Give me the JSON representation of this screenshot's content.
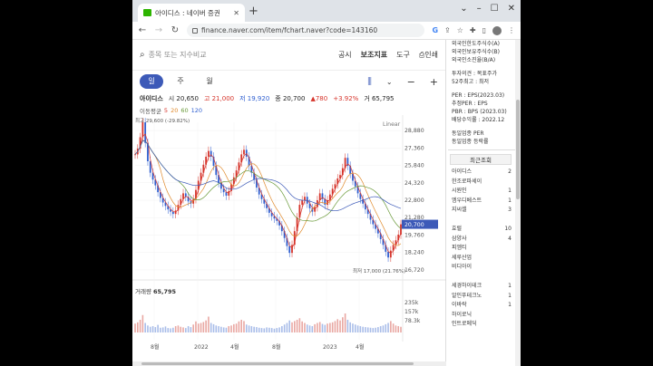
{
  "browser": {
    "tab_title": "아이디스 : 네이버 증권",
    "url": "finance.naver.com/item/fchart.naver?code=143160"
  },
  "toolbar": {
    "search_placeholder": "종목 또는 지수비교",
    "items": [
      "공시",
      "보조지표",
      "도구",
      "인쇄"
    ]
  },
  "periods": [
    "일",
    "주",
    "월"
  ],
  "active_period": "일",
  "quote": {
    "name": "아이디스",
    "open": "시 20,650",
    "high": "고 21,000",
    "low": "저 19,920",
    "close": "종 20,700",
    "change": "▲780",
    "pct": "+3.92%",
    "volume": "거 65,795"
  },
  "ma_legend": {
    "label": "이동평균",
    "values": [
      "5",
      "20",
      "60",
      "120"
    ]
  },
  "chart_data": {
    "type": "line",
    "price_axis": {
      "ticks": [
        28880,
        27360,
        25840,
        24320,
        22800,
        21280,
        19760,
        18240,
        16720
      ],
      "range": [
        16000,
        29600
      ]
    },
    "x_ticks": [
      "8월",
      "2022",
      "4월",
      "8월",
      "2023",
      "4월"
    ],
    "scale_label": "Linear",
    "last_price_label": "20,700",
    "high_marker": "최고 29,600 (-29.82%)",
    "low_marker": "최저 17,000 (21.76%)",
    "volume": {
      "label": "거래량",
      "value": "65,795",
      "ticks": [
        "235k",
        "157k",
        "78.3k"
      ]
    },
    "close_series": [
      26800,
      27300,
      28300,
      29600,
      27800,
      26200,
      25200,
      24600,
      24100,
      23500,
      23000,
      22600,
      22300,
      22000,
      21800,
      21600,
      21900,
      22400,
      22900,
      23400,
      23100,
      22700,
      22500,
      22900,
      23700,
      24500,
      25200,
      25900,
      26600,
      27100,
      26600,
      25800,
      25000,
      24300,
      23800,
      23500,
      23200,
      23600,
      24200,
      24800,
      25400,
      26100,
      26800,
      27200,
      26600,
      25800,
      25200,
      24600,
      23900,
      23300,
      22900,
      22500,
      22100,
      21700,
      21400,
      21200,
      21000,
      20600,
      20100,
      19500,
      18800,
      18200,
      18900,
      20100,
      21300,
      22400,
      22800,
      23100,
      22500,
      22100,
      21800,
      22200,
      22800,
      23400,
      22900,
      22400,
      22800,
      23300,
      23800,
      24200,
      24700,
      25000,
      25600,
      26500,
      25800,
      25100,
      24500,
      24000,
      23400,
      22900,
      22500,
      22000,
      21600,
      21100,
      20700,
      20300,
      19900,
      19400,
      18900,
      18300,
      17800,
      18400,
      18900,
      19300,
      19800,
      20700
    ],
    "volume_series": [
      0.28,
      0.32,
      0.4,
      0.55,
      0.3,
      0.22,
      0.18,
      0.2,
      0.17,
      0.24,
      0.15,
      0.16,
      0.19,
      0.14,
      0.13,
      0.15,
      0.2,
      0.22,
      0.18,
      0.16,
      0.14,
      0.2,
      0.17,
      0.25,
      0.35,
      0.28,
      0.3,
      0.33,
      0.38,
      0.5,
      0.3,
      0.26,
      0.22,
      0.2,
      0.18,
      0.16,
      0.15,
      0.2,
      0.22,
      0.26,
      0.28,
      0.35,
      0.4,
      0.36,
      0.25,
      0.22,
      0.2,
      0.18,
      0.17,
      0.15,
      0.14,
      0.13,
      0.16,
      0.15,
      0.14,
      0.12,
      0.14,
      0.16,
      0.2,
      0.25,
      0.3,
      0.38,
      0.32,
      0.36,
      0.4,
      0.45,
      0.35,
      0.3,
      0.25,
      0.22,
      0.2,
      0.26,
      0.3,
      0.33,
      0.27,
      0.24,
      0.28,
      0.3,
      0.32,
      0.36,
      0.42,
      0.38,
      0.48,
      0.6,
      0.4,
      0.32,
      0.28,
      0.25,
      0.22,
      0.2,
      0.18,
      0.17,
      0.16,
      0.15,
      0.14,
      0.15,
      0.17,
      0.2,
      0.22,
      0.26,
      0.3,
      0.36,
      0.28,
      0.22,
      0.2,
      0.18
    ]
  },
  "colors": {
    "up": "#d6342b",
    "down": "#2f5fd0",
    "ma5": "#d6342b",
    "ma20": "#e08a2c",
    "ma60": "#6a9a3a",
    "ma120": "#3d5ab8"
  },
  "sidebar": {
    "top_lines": [
      "외국인한도주식수(A)",
      "외국인보유주식수(B)",
      "외국인소진율(B/A)"
    ],
    "mid_lines": [
      "투자의견 : 목표주가",
      "52주최고 : 최저"
    ],
    "per_lines": [
      "PER : EPS(2023.03)",
      "추정PER : EPS",
      "PBR : BPS (2023.03)",
      "배당수익률 : 2022.12"
    ],
    "ind_lines": [
      "동일업종 PER",
      "동일업종 등락률"
    ],
    "recent_tab": "최근조회",
    "recent": [
      {
        "name": "아이디스",
        "val": "2"
      },
      {
        "name": "한조로파세이",
        "val": ""
      },
      {
        "name": "시원인",
        "val": "1"
      },
      {
        "name": "엠우디베스트",
        "val": "1"
      },
      {
        "name": "지씨셀",
        "val": "3"
      },
      {
        "name": "",
        "val": ""
      },
      {
        "name": "효럴",
        "val": "10"
      },
      {
        "name": "삼양사",
        "val": "4"
      },
      {
        "name": "피엠티",
        "val": ""
      },
      {
        "name": "세루산업",
        "val": ""
      },
      {
        "name": "비디아이",
        "val": ""
      },
      {
        "name": "",
        "val": ""
      },
      {
        "name": "세경하이테크",
        "val": "1"
      },
      {
        "name": "알인푸테크노",
        "val": "1"
      },
      {
        "name": "이바락",
        "val": "1"
      },
      {
        "name": "하이로닉",
        "val": ""
      },
      {
        "name": "인트로메딕",
        "val": ""
      }
    ]
  }
}
